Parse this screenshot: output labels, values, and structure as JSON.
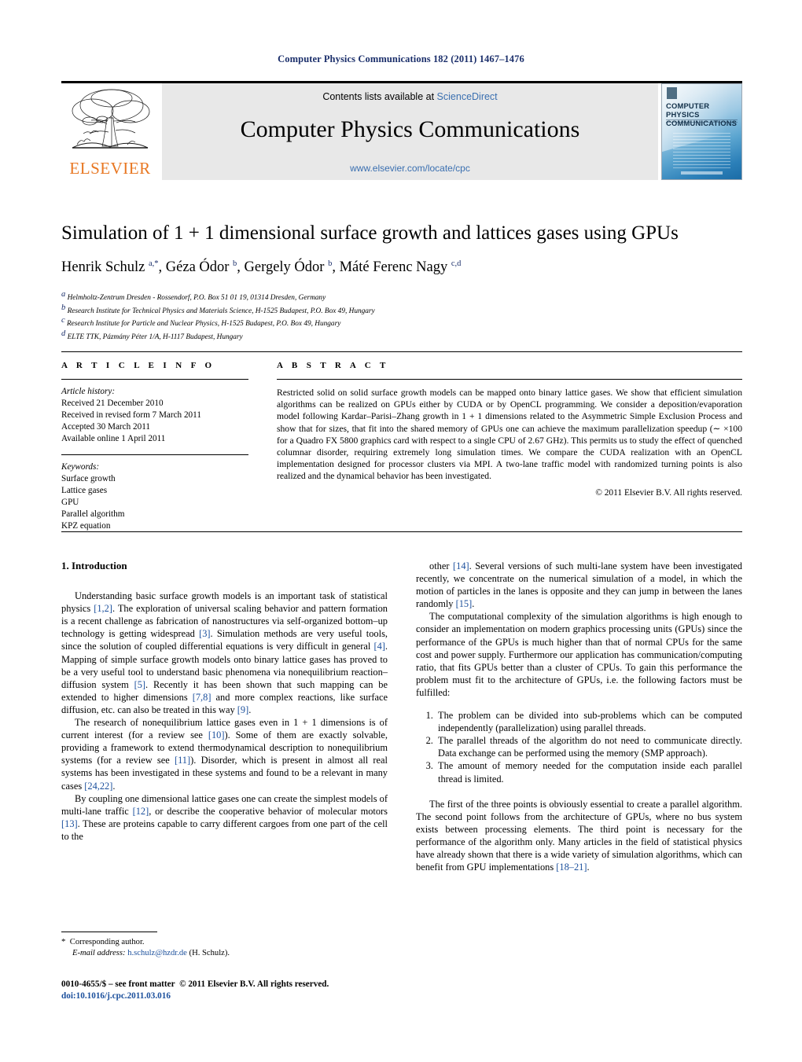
{
  "running_head": "Computer Physics Communications 182 (2011) 1467–1476",
  "masthead": {
    "publisher_name": "ELSEVIER",
    "contents_prefix": "Contents lists available at",
    "contents_link": "ScienceDirect",
    "journal_title": "Computer Physics Communications",
    "journal_url": "www.elsevier.com/locate/cpc",
    "cover_title_line1": "COMPUTER PHYSICS",
    "cover_title_line2": "COMMUNICATIONS",
    "link_color": "#3a6fb0",
    "elsevier_orange": "#e87722"
  },
  "article": {
    "title": "Simulation of 1 + 1 dimensional surface growth and lattices gases using GPUs",
    "authors_html": "Henrik Schulz <sup>a,*</sup>, Géza Ódor <sup>b</sup>, Gergely Ódor <sup>b</sup>, Máté Ferenc Nagy <sup>c,d</sup>",
    "affiliations": [
      {
        "mark": "a",
        "text": "Helmholtz-Zentrum Dresden - Rossendorf, P.O. Box 51 01 19, 01314 Dresden, Germany"
      },
      {
        "mark": "b",
        "text": "Research Institute for Technical Physics and Materials Science, H-1525 Budapest, P.O. Box 49, Hungary"
      },
      {
        "mark": "c",
        "text": "Research Institute for Particle and Nuclear Physics, H-1525 Budapest, P.O. Box 49, Hungary"
      },
      {
        "mark": "d",
        "text": "ELTE TTK, Pázmány Péter 1/A, H-1117 Budapest, Hungary"
      }
    ]
  },
  "article_info": {
    "heading": "A R T I C L E   I N F O",
    "history_label": "Article history:",
    "history": [
      "Received 21 December 2010",
      "Received in revised form 7 March 2011",
      "Accepted 30 March 2011",
      "Available online 1 April 2011"
    ],
    "keywords_label": "Keywords:",
    "keywords": [
      "Surface growth",
      "Lattice gases",
      "GPU",
      "Parallel algorithm",
      "KPZ equation"
    ]
  },
  "abstract": {
    "heading": "A B S T R A C T",
    "text": "Restricted solid on solid surface growth models can be mapped onto binary lattice gases. We show that efficient simulation algorithms can be realized on GPUs either by CUDA or by OpenCL programming. We consider a deposition/evaporation model following Kardar–Parisi–Zhang growth in 1 + 1 dimensions related to the Asymmetric Simple Exclusion Process and show that for sizes, that fit into the shared memory of GPUs one can achieve the maximum parallelization speedup (∼ ×100 for a Quadro FX 5800 graphics card with respect to a single CPU of 2.67 GHz). This permits us to study the effect of quenched columnar disorder, requiring extremely long simulation times. We compare the CUDA realization with an OpenCL implementation designed for processor clusters via MPI. A two-lane traffic model with randomized turning points is also realized and the dynamical behavior has been investigated.",
    "copyright": "© 2011 Elsevier B.V. All rights reserved."
  },
  "body": {
    "section_heading": "1. Introduction",
    "left_paragraphs": [
      "Understanding basic surface growth models is an important task of statistical physics [1,2]. The exploration of universal scaling behavior and pattern formation is a recent challenge as fabrication of nanostructures via self-organized bottom–up technology is getting widespread [3]. Simulation methods are very useful tools, since the solution of coupled differential equations is very difficult in general [4]. Mapping of simple surface growth models onto binary lattice gases has proved to be a very useful tool to understand basic phenomena via nonequilibrium reaction–diffusion system [5]. Recently it has been shown that such mapping can be extended to higher dimensions [7,8] and more complex reactions, like surface diffusion, etc. can also be treated in this way [9].",
      "The research of nonequilibrium lattice gases even in 1 + 1 dimensions is of current interest (for a review see [10]). Some of them are exactly solvable, providing a framework to extend thermodynamical description to nonequilibrium systems (for a review see [11]). Disorder, which is present in almost all real systems has been investigated in these systems and found to be a relevant in many cases [24,22].",
      "By coupling one dimensional lattice gases one can create the simplest models of multi-lane traffic [12], or describe the cooperative behavior of molecular motors [13]. These are proteins capable to carry different cargoes from one part of the cell to the"
    ],
    "right_paragraphs_before_list": [
      "other [14]. Several versions of such multi-lane system have been investigated recently, we concentrate on the numerical simulation of a model, in which the motion of particles in the lanes is opposite and they can jump in between the lanes randomly [15].",
      "The computational complexity of the simulation algorithms is high enough to consider an implementation on modern graphics processing units (GPUs) since the performance of the GPUs is much higher than that of normal CPUs for the same cost and power supply. Furthermore our application has communication/computing ratio, that fits GPUs better than a cluster of CPUs. To gain this performance the problem must fit to the architecture of GPUs, i.e. the following factors must be fulfilled:"
    ],
    "numbered_list": [
      "The problem can be divided into sub-problems which can be computed independently (parallelization) using parallel threads.",
      "The parallel threads of the algorithm do not need to communicate directly. Data exchange can be performed using the memory (SMP approach).",
      "The amount of memory needed for the computation inside each parallel thread is limited."
    ],
    "right_paragraphs_after_list": [
      "The first of the three points is obviously essential to create a parallel algorithm. The second point follows from the architecture of GPUs, where no bus system exists between processing elements. The third point is necessary for the performance of the algorithm only. Many articles in the field of statistical physics have already shown that there is a wide variety of simulation algorithms, which can benefit from GPU implementations [18–21]."
    ]
  },
  "footnote": {
    "star": "*",
    "corresponding": "Corresponding author.",
    "email_label": "E-mail address:",
    "email": "h.schulz@hzdr.de",
    "email_owner": "(H. Schulz)."
  },
  "footer": {
    "issn_line": "0010-4655/$ – see front matter",
    "copyright": "© 2011 Elsevier B.V. All rights reserved.",
    "doi": "doi:10.1016/j.cpc.2011.03.016"
  }
}
